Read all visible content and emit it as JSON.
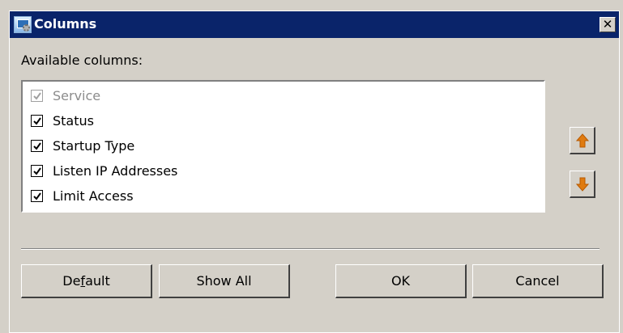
{
  "dialog": {
    "title": "Columns",
    "close_glyph": "✕"
  },
  "available_columns_label": "Available columns:",
  "columns": [
    {
      "label": "Service",
      "checked": true,
      "disabled": true
    },
    {
      "label": "Status",
      "checked": true,
      "disabled": false
    },
    {
      "label": "Startup Type",
      "checked": true,
      "disabled": false
    },
    {
      "label": "Listen IP Addresses",
      "checked": true,
      "disabled": false
    },
    {
      "label": "Limit Access",
      "checked": true,
      "disabled": false
    }
  ],
  "buttons": {
    "default_pre": "De",
    "default_mnemonic": "f",
    "default_post": "ault",
    "show_all": "Show All",
    "ok": "OK",
    "cancel": "Cancel"
  },
  "icons": {
    "app": "app-icon",
    "move_up": "arrow-up-icon",
    "move_down": "arrow-down-icon"
  },
  "colors": {
    "titlebar": "#0a246a",
    "dialog_bg": "#d4d0c8",
    "arrow": "#e07b10"
  }
}
